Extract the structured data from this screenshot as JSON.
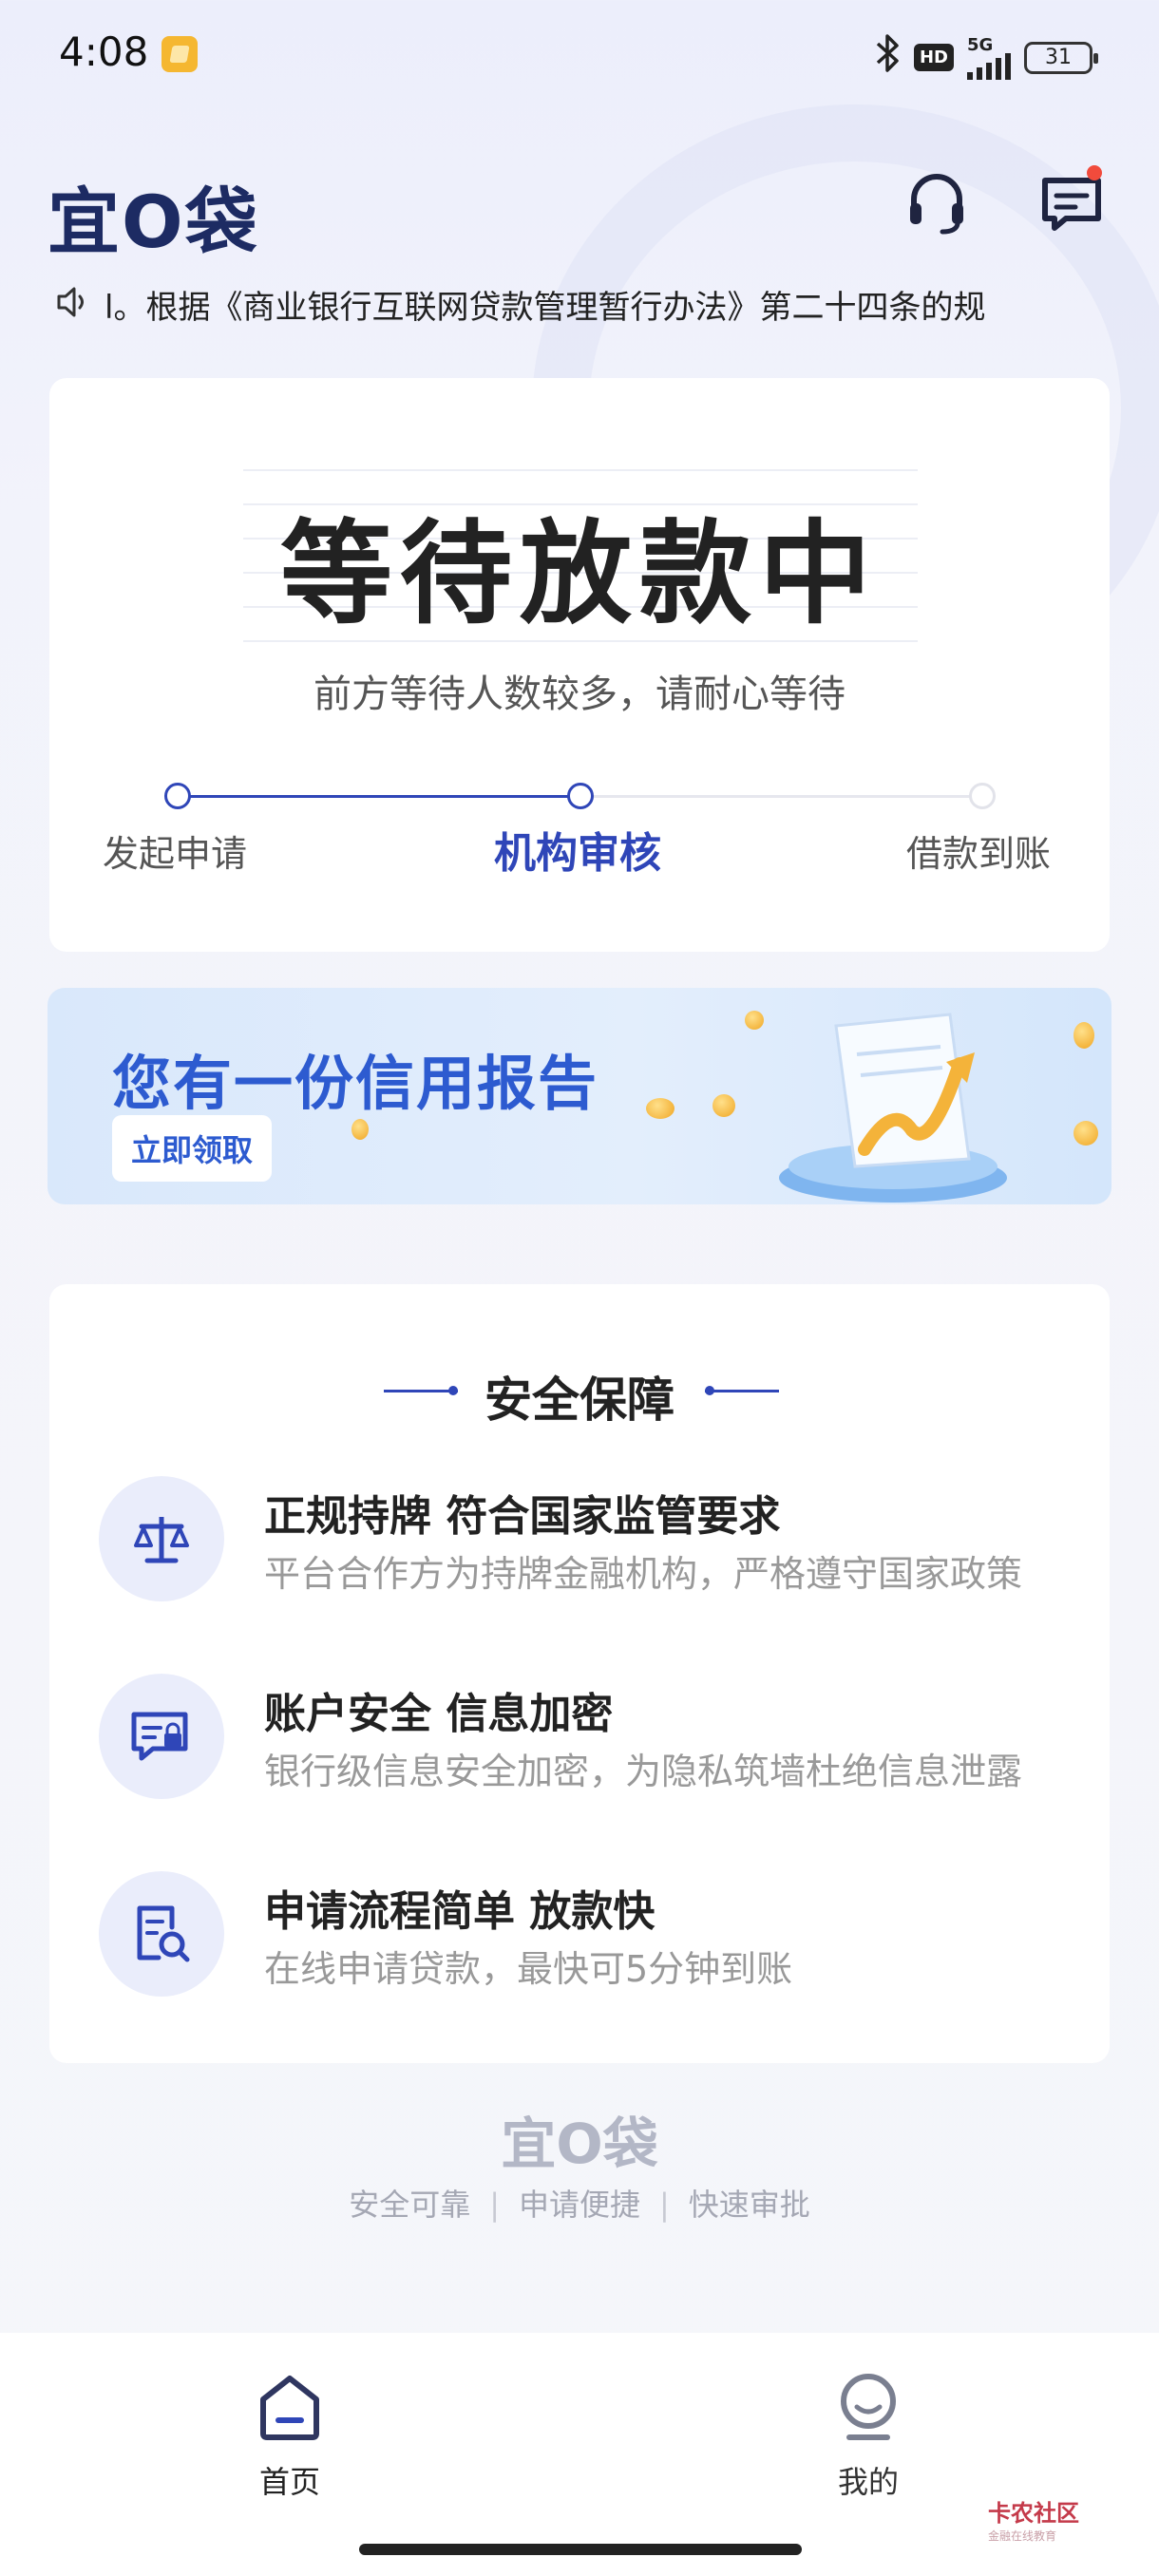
{
  "status_bar": {
    "time": "4:08",
    "hd_badge": "HD",
    "network": "5G",
    "battery": "31"
  },
  "header": {
    "logo": "宜O袋",
    "headset_icon": "headset-icon",
    "message_icon": "message-icon"
  },
  "notice": {
    "icon": "speaker-icon",
    "text": "l。根据《商业银行互联网贷款管理暂行办法》第二十四条的规"
  },
  "loan_status": {
    "title": "等待放款中",
    "subtitle": "前方等待人数较多，请耐心等待",
    "steps": [
      {
        "label": "发起申请",
        "state": "done"
      },
      {
        "label": "机构审核",
        "state": "current"
      },
      {
        "label": "借款到账",
        "state": "pending"
      }
    ]
  },
  "banner": {
    "title": "您有一份信用报告",
    "button": "立即领取"
  },
  "security": {
    "title": "安全保障",
    "items": [
      {
        "icon": "scale-icon",
        "title": "正规持牌 符合国家监管要求",
        "desc": "平台合作方为持牌金融机构，严格遵守国家政策"
      },
      {
        "icon": "secure-chat-icon",
        "title": "账户安全 信息加密",
        "desc": "银行级信息安全加密，为隐私筑墙杜绝信息泄露"
      },
      {
        "icon": "document-search-icon",
        "title": "申请流程简单 放款快",
        "desc": "在线申请贷款，最快可5分钟到账"
      }
    ]
  },
  "footer": {
    "logo": "宜O袋",
    "tags": [
      "安全可靠",
      "申请便捷",
      "快速审批"
    ]
  },
  "bottom_nav": {
    "items": [
      {
        "label": "首页",
        "icon": "home-icon",
        "active": true
      },
      {
        "label": "我的",
        "icon": "profile-icon",
        "active": false
      }
    ]
  },
  "watermark": {
    "text": "卡农社区",
    "sub": "金融在线教育"
  },
  "colors": {
    "accent": "#2f46b8",
    "banner_blue": "#2d5bd0",
    "dot_red": "#f14b3c"
  }
}
